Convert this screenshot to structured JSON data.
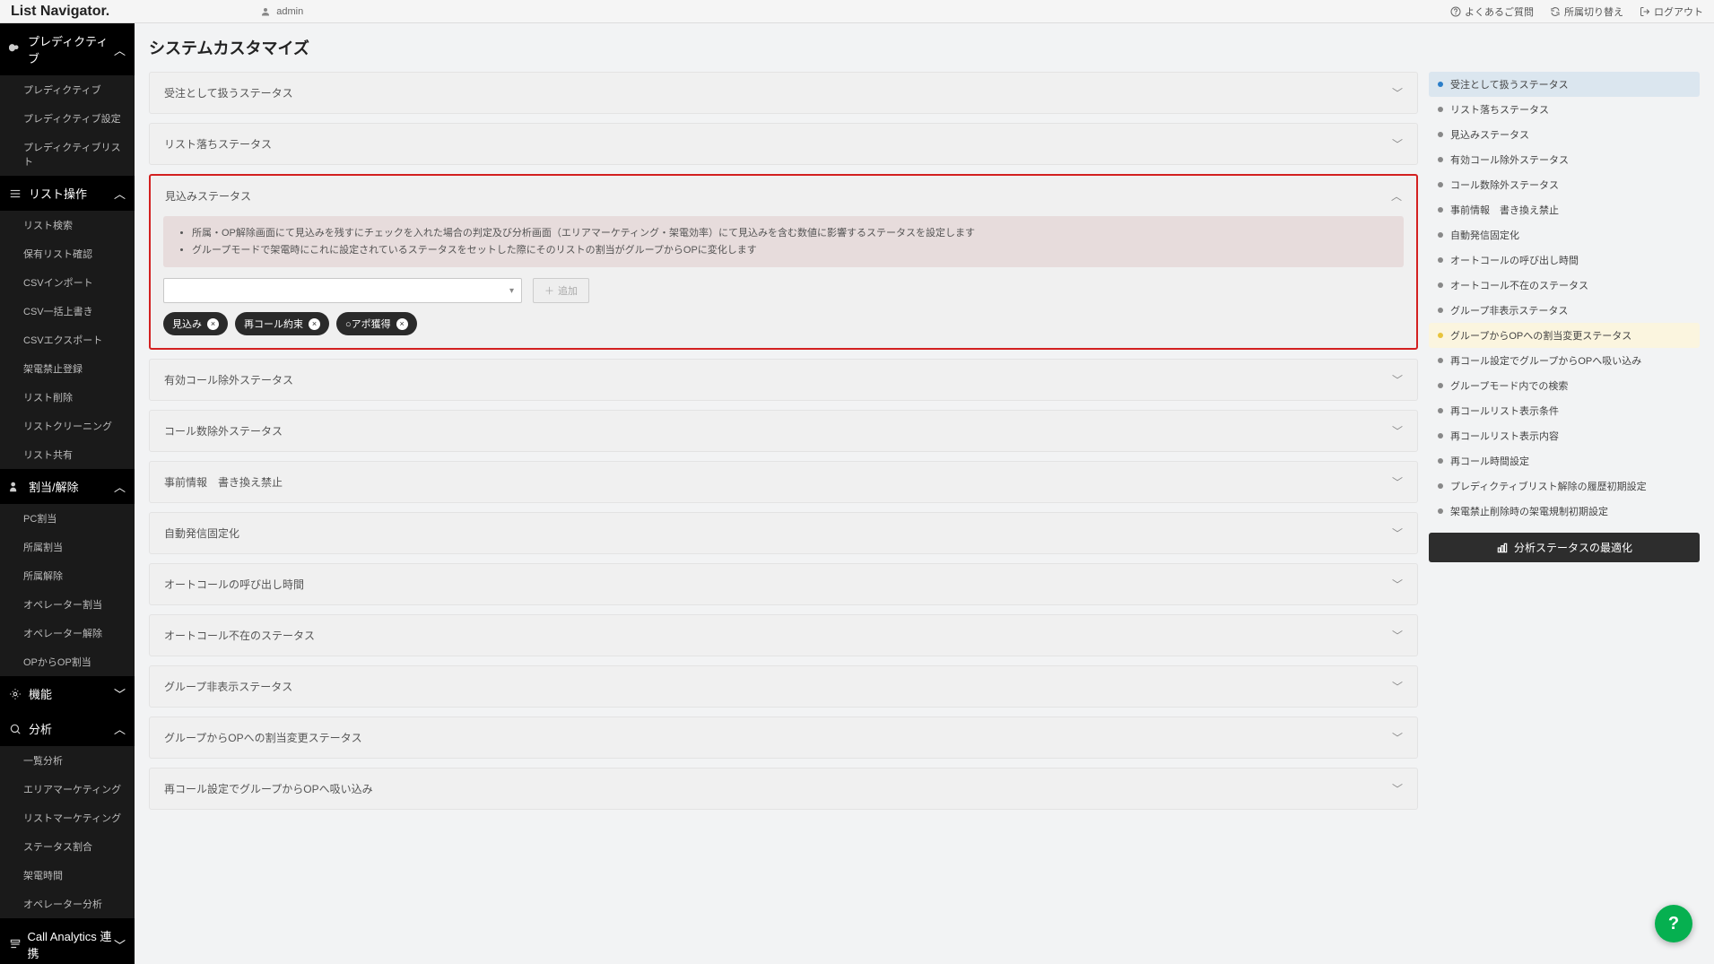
{
  "topbar": {
    "brand": "List Navigator.",
    "user": "admin",
    "links": {
      "faq": "よくあるご質問",
      "switch": "所属切り替え",
      "logout": "ログアウト"
    }
  },
  "sidebar": {
    "sections": [
      {
        "label": "プレディクティブ",
        "open": true,
        "items": [
          "プレディクティブ",
          "プレディクティブ設定",
          "プレディクティブリスト"
        ]
      },
      {
        "label": "リスト操作",
        "open": true,
        "items": [
          "リスト検索",
          "保有リスト確認",
          "CSVインポート",
          "CSV一括上書き",
          "CSVエクスポート",
          "架電禁止登録",
          "リスト削除",
          "リストクリーニング",
          "リスト共有"
        ]
      },
      {
        "label": "割当/解除",
        "open": true,
        "items": [
          "PC割当",
          "所属割当",
          "所属解除",
          "オペレーター割当",
          "オペレーター解除",
          "OPからOP割当"
        ]
      },
      {
        "label": "機能",
        "open": false,
        "items": []
      },
      {
        "label": "分析",
        "open": true,
        "items": [
          "一覧分析",
          "エリアマーケティング",
          "リストマーケティング",
          "ステータス割合",
          "架電時間",
          "オペレーター分析"
        ]
      },
      {
        "label": "Call Analytics 連携",
        "open": false,
        "items": []
      }
    ]
  },
  "page": {
    "title": "システムカスタマイズ",
    "panels": [
      {
        "title": "受注として扱うステータス",
        "open": false
      },
      {
        "title": "リスト落ちステータス",
        "open": false
      },
      {
        "title": "見込みステータス",
        "open": true,
        "highlighted": true,
        "info": [
          "所属・OP解除画面にて見込みを残すにチェックを入れた場合の判定及び分析画面（エリアマーケティング・架電効率）にて見込みを含む数値に影響するステータスを設定します",
          "グループモードで架電時にこれに設定されているステータスをセットした際にそのリストの割当がグループからOPに変化します"
        ],
        "add_btn": "追加",
        "tags": [
          "見込み",
          "再コール約束",
          "○アポ獲得"
        ]
      },
      {
        "title": "有効コール除外ステータス",
        "open": false
      },
      {
        "title": "コール数除外ステータス",
        "open": false
      },
      {
        "title": "事前情報　書き換え禁止",
        "open": false
      },
      {
        "title": "自動発信固定化",
        "open": false
      },
      {
        "title": "オートコールの呼び出し時間",
        "open": false
      },
      {
        "title": "オートコール不在のステータス",
        "open": false
      },
      {
        "title": "グループ非表示ステータス",
        "open": false
      },
      {
        "title": "グループからOPへの割当変更ステータス",
        "open": false
      },
      {
        "title": "再コール設定でグループからOPへ吸い込み",
        "open": false
      }
    ],
    "anchors": [
      {
        "label": "受注として扱うステータス",
        "state": "active"
      },
      {
        "label": "リスト落ちステータス",
        "state": "default"
      },
      {
        "label": "見込みステータス",
        "state": "default"
      },
      {
        "label": "有効コール除外ステータス",
        "state": "default"
      },
      {
        "label": "コール数除外ステータス",
        "state": "default"
      },
      {
        "label": "事前情報　書き換え禁止",
        "state": "default"
      },
      {
        "label": "自動発信固定化",
        "state": "default"
      },
      {
        "label": "オートコールの呼び出し時間",
        "state": "default"
      },
      {
        "label": "オートコール不在のステータス",
        "state": "default"
      },
      {
        "label": "グループ非表示ステータス",
        "state": "default"
      },
      {
        "label": "グループからOPへの割当変更ステータス",
        "state": "pending"
      },
      {
        "label": "再コール設定でグループからOPへ吸い込み",
        "state": "default"
      },
      {
        "label": "グループモード内での検索",
        "state": "default"
      },
      {
        "label": "再コールリスト表示条件",
        "state": "default"
      },
      {
        "label": "再コールリスト表示内容",
        "state": "default"
      },
      {
        "label": "再コール時間設定",
        "state": "default"
      },
      {
        "label": "プレディクティブリスト解除の履歴初期設定",
        "state": "default"
      },
      {
        "label": "架電禁止削除時の架電規制初期設定",
        "state": "default"
      }
    ],
    "optimize_btn": "分析ステータスの最適化"
  }
}
